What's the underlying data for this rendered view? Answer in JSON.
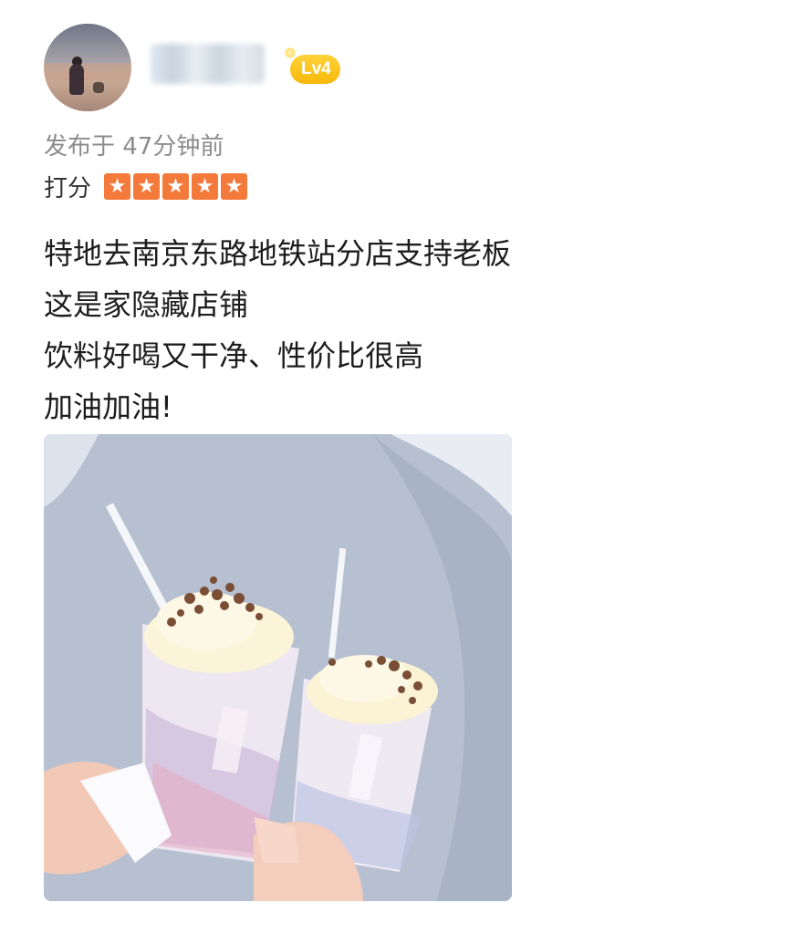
{
  "user": {
    "avatar_icon": "user-avatar",
    "level_badge": "Lv4"
  },
  "post": {
    "time_text": "发布于 47分钟前",
    "rating_label": "打分",
    "rating": {
      "value": 5,
      "max": 5,
      "color": "#f47a3c"
    },
    "review_lines": [
      "特地去南京东路地铁站分店支持老板",
      "这是家隐藏店铺",
      "饮料好喝又干净、性价比很高",
      "加油加油!"
    ],
    "photo_icon": "photo-two-milkshakes"
  }
}
